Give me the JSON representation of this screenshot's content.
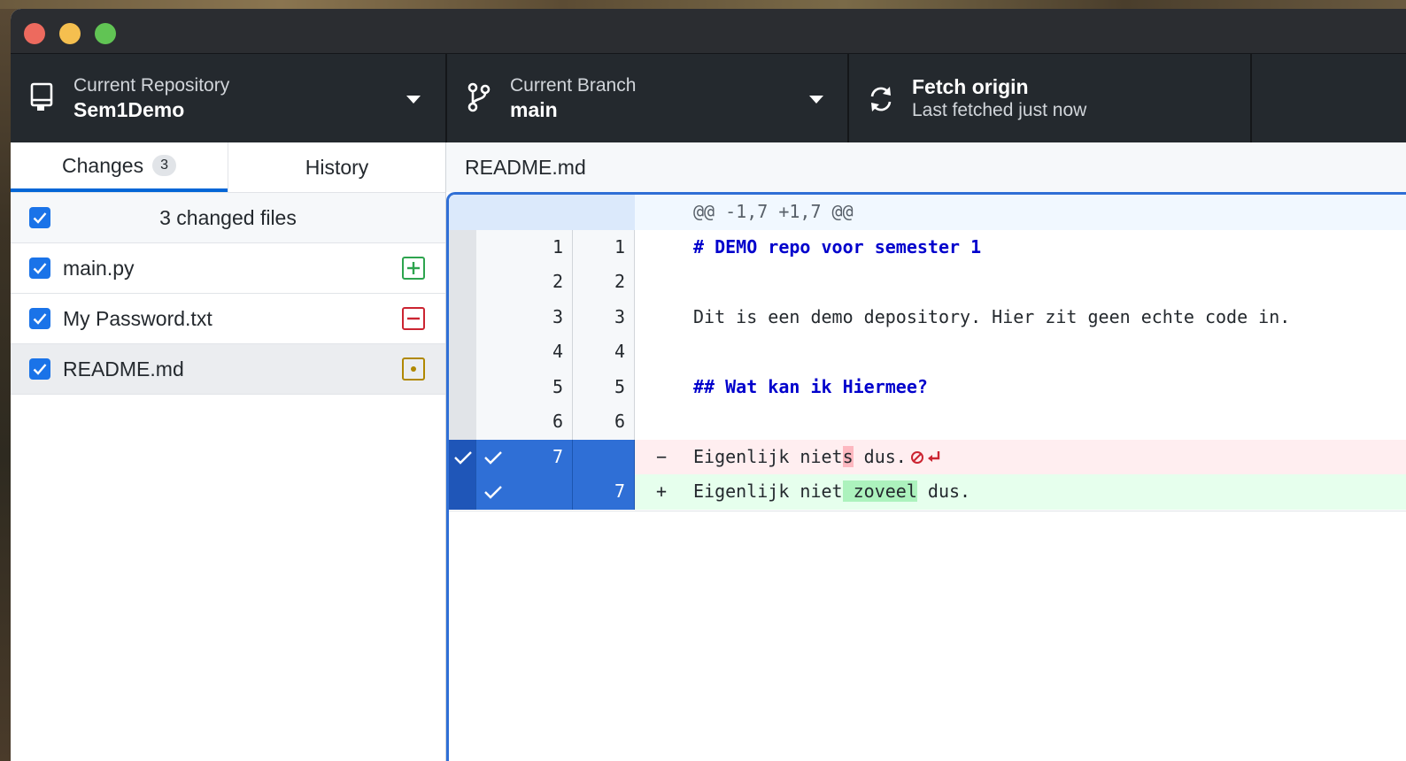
{
  "toolbar": {
    "repository": {
      "label": "Current Repository",
      "value": "Sem1Demo"
    },
    "branch": {
      "label": "Current Branch",
      "value": "main"
    },
    "fetch": {
      "title": "Fetch origin",
      "subtitle": "Last fetched just now"
    }
  },
  "sidebar": {
    "tabs": [
      {
        "label": "Changes",
        "count": "3"
      },
      {
        "label": "History"
      }
    ],
    "summary": "3 changed files",
    "files": [
      {
        "name": "main.py",
        "status": "added"
      },
      {
        "name": "My Password.txt",
        "status": "deleted"
      },
      {
        "name": "README.md",
        "status": "modified"
      }
    ]
  },
  "diff": {
    "file": "README.md",
    "hunk": "@@ -1,7 +1,7 @@",
    "lines": [
      {
        "old": "1",
        "new": "1",
        "text": "# DEMO repo voor semester 1"
      },
      {
        "old": "2",
        "new": "2",
        "text": ""
      },
      {
        "old": "3",
        "new": "3",
        "text": "Dit is een demo depository. Hier zit geen echte code in."
      },
      {
        "old": "4",
        "new": "4",
        "text": ""
      },
      {
        "old": "5",
        "new": "5",
        "text": "## Wat kan ik Hiermee?"
      },
      {
        "old": "6",
        "new": "6",
        "text": ""
      }
    ],
    "deleted": {
      "old": "7",
      "mark": "−",
      "pre": "Eigenlijk niet",
      "hl": "s",
      "post": " dus."
    },
    "added": {
      "new": "7",
      "mark": "+",
      "pre": "Eigenlijk niet",
      "hl": " zoveel",
      "post": " dus."
    }
  },
  "colors": {
    "accent": "#0366d6",
    "added": "#2da44e",
    "deleted": "#cb2431",
    "modified": "#b08800"
  }
}
